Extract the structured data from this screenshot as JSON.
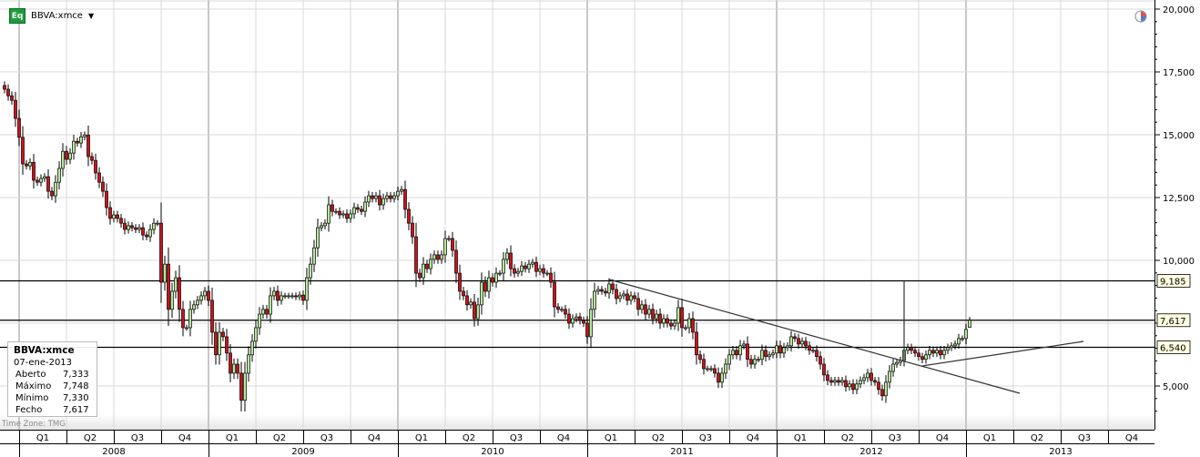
{
  "header": {
    "badge": "Eq",
    "symbol": "BBVA:xmce",
    "dropdown_icon": "caret-down-icon"
  },
  "info_box": {
    "title": "BBVA:xmce",
    "date": "07-ene-2013",
    "rows": [
      {
        "label": "Aberto",
        "value": "7,333"
      },
      {
        "label": "Máximo",
        "value": "7,748"
      },
      {
        "label": "Mínimo",
        "value": "7,330"
      },
      {
        "label": "Fecho",
        "value": "7,617"
      }
    ]
  },
  "timezone": "Time Zone: TMG",
  "colors": {
    "up": "#b6e89a",
    "down": "#d0101a",
    "outline": "#000000",
    "grid": "#d9d9d9",
    "marker_bg": "#ffffe1"
  },
  "chart_data": {
    "type": "candlestick",
    "interval": "weekly",
    "last_date": "07-ene-2013",
    "last_candle": {
      "open": 7333,
      "high": 7748,
      "low": 7330,
      "close": 7617
    },
    "ylim": [
      3500,
      20500
    ],
    "yticks": [
      {
        "v": 20000,
        "label": "20,000"
      },
      {
        "v": 17500,
        "label": "17,500"
      },
      {
        "v": 15000,
        "label": "15,000"
      },
      {
        "v": 12500,
        "label": "12,500"
      },
      {
        "v": 10000,
        "label": "10,000"
      },
      {
        "v": 5000,
        "label": "5,000"
      }
    ],
    "price_markers": [
      {
        "v": 9185,
        "label": "9,185"
      },
      {
        "v": 7617,
        "label": "7,617"
      },
      {
        "v": 6540,
        "label": "6,540"
      }
    ],
    "quarters": [
      "Q1",
      "Q2",
      "Q3",
      "Q4",
      "Q1",
      "Q2",
      "Q3",
      "Q4",
      "Q1",
      "Q2",
      "Q3",
      "Q4",
      "Q1",
      "Q2",
      "Q3",
      "Q4",
      "Q1",
      "Q2",
      "Q3",
      "Q4",
      "Q1",
      "Q2",
      "Q3",
      "Q4"
    ],
    "years": [
      "2008",
      "2009",
      "2010",
      "2011",
      "2012",
      "2013"
    ],
    "grid": true,
    "closes": [
      16810,
      16550,
      16370,
      15650,
      14900,
      13840,
      13760,
      13900,
      13190,
      13110,
      13260,
      13330,
      12750,
      12570,
      13110,
      13660,
      14340,
      14020,
      14270,
      14740,
      14670,
      14920,
      14990,
      14130,
      13980,
      13480,
      13110,
      12750,
      12100,
      11670,
      11810,
      11670,
      11480,
      11230,
      11380,
      11300,
      11230,
      11300,
      11010,
      10940,
      11230,
      11480,
      11480,
      9130,
      9850,
      8050,
      8770,
      9310,
      8050,
      7320,
      7320,
      8050,
      8230,
      8410,
      8590,
      8770,
      8410,
      7140,
      6240,
      7140,
      6960,
      6310,
      5510,
      5870,
      5510,
      4430,
      5510,
      6240,
      6780,
      7320,
      7860,
      8050,
      7860,
      8590,
      8770,
      8410,
      8590,
      8590,
      8590,
      8590,
      8550,
      8620,
      8410,
      9310,
      9850,
      10500,
      11300,
      11380,
      11480,
      12210,
      11950,
      11950,
      11810,
      11850,
      11670,
      11850,
      12100,
      12030,
      11950,
      12320,
      12570,
      12460,
      12570,
      12210,
      12460,
      12570,
      12460,
      12570,
      12750,
      12820,
      12030,
      11480,
      10940,
      9490,
      9310,
      9850,
      9670,
      10040,
      10220,
      10040,
      10220,
      10870,
      10870,
      10400,
      9490,
      8770,
      8590,
      8230,
      8340,
      7680,
      8230,
      9130,
      8770,
      9310,
      9130,
      9490,
      9490,
      10040,
      10290,
      9670,
      9490,
      9560,
      9780,
      9670,
      9850,
      9920,
      9560,
      9670,
      9490,
      9490,
      9130,
      8150,
      8050,
      8050,
      7860,
      7500,
      7680,
      7750,
      7610,
      7500,
      6960,
      8050,
      8770,
      8840,
      8770,
      8700,
      9060,
      8840,
      8480,
      8590,
      8660,
      8410,
      8590,
      8480,
      8050,
      8230,
      7860,
      8050,
      7680,
      7860,
      7500,
      7680,
      7500,
      7390,
      7500,
      8120,
      7320,
      7320,
      7680,
      7140,
      6240,
      6060,
      5690,
      5690,
      5690,
      5510,
      5150,
      5510,
      5870,
      6240,
      6420,
      6240,
      6600,
      6670,
      6060,
      5870,
      6060,
      6060,
      6420,
      6170,
      6240,
      6310,
      6600,
      6310,
      6530,
      6600,
      6960,
      6890,
      6670,
      6780,
      6600,
      6420,
      6420,
      6170,
      5870,
      5440,
      5220,
      5150,
      5220,
      5150,
      5220,
      4970,
      5080,
      4860,
      5080,
      5220,
      5330,
      5510,
      5220,
      5150,
      4860,
      4610,
      5150,
      5580,
      5870,
      5940,
      6020,
      6420,
      6530,
      6420,
      6310,
      6170,
      6060,
      6240,
      6420,
      6310,
      6420,
      6240,
      6420,
      6530,
      6600,
      6670,
      6890,
      6890,
      7250,
      7617
    ]
  }
}
